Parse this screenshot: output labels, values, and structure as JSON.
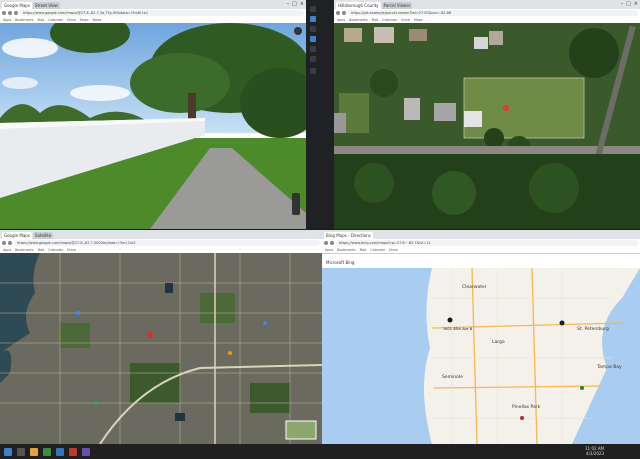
{
  "windows": {
    "street_view": {
      "tabs": [
        "Google Maps",
        "Street View"
      ],
      "url": "https://www.google.com/maps/@27.8,-82.7,3a,75y,90t/data=!3m6!1e1",
      "bookmarks": [
        "Apps",
        "Bookmarks",
        "Mail",
        "Calendar",
        "Drive",
        "Maps",
        "News",
        "Photos",
        "YouTube"
      ]
    },
    "aerial": {
      "tabs": [
        "Hillsborough County",
        "Parcel Viewer"
      ],
      "url": "https://gis.example/parcel-viewer?lat=27.83&lon=-82.68",
      "bookmarks": [
        "Apps",
        "Bookmarks",
        "Mail",
        "Calendar",
        "Drive",
        "Maps",
        "News",
        "Photos"
      ]
    },
    "satellite": {
      "tabs": [
        "Google Maps",
        "Satellite"
      ],
      "url": "https://www.google.com/maps/@27.8,-82.7,5000m/data=!3m1!1e3",
      "bookmarks": [
        "Apps",
        "Bookmarks",
        "Mail",
        "Calendar",
        "Drive",
        "Maps",
        "News",
        "Photos"
      ]
    },
    "bing": {
      "tabs": [
        "Bing Maps - Directions"
      ],
      "url": "https://www.bing.com/maps?cp=27.8~-82.7&lvl=11",
      "bookmarks": [
        "Apps",
        "Bookmarks",
        "Mail",
        "Calendar",
        "Drive",
        "Maps",
        "News",
        "Photos"
      ],
      "brand": "Microsoft Bing",
      "place_labels": [
        "Clearwater",
        "St. Petersburg",
        "Largo",
        "Pinellas Park",
        "Seminole",
        "Tampa Bay"
      ],
      "pin_label": "1602 48th Ave N"
    }
  },
  "taskbar": {
    "time": "11:02 AM",
    "date": "4/3/2023"
  },
  "colors": {
    "sky": "#a9cff2",
    "grass": "#4d8a2a",
    "water": "#a8cdf0",
    "road": "#f2b94f"
  }
}
